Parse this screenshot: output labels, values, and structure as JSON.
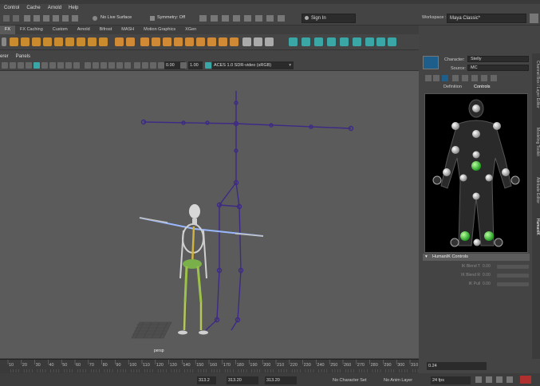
{
  "menu": [
    "Control",
    "Cache",
    "Arnold",
    "Help"
  ],
  "statusline": {
    "live_surface": "No Live Surface",
    "symmetry": "Symmetry: Off",
    "sign_in": "Sign In",
    "workspace_label": "Workspace :",
    "workspace_value": "Maya Classic*"
  },
  "shelf_tabs": [
    "FX",
    "FX Caching",
    "Custom",
    "Arnold",
    "Bifrost",
    "MASH",
    "Motion Graphics",
    "XGen"
  ],
  "panel_menu": [
    "erer",
    "Panels"
  ],
  "viewport_toolbar": {
    "value_a": "0.00",
    "value_b": "1.00",
    "colorspace": "ACES 1.0 SDR-video (sRGB)"
  },
  "viewport": {
    "camera_label": "persp"
  },
  "humanik": {
    "character_label": "Character:",
    "character_value": "Stelly",
    "source_label": "Source:",
    "source_value": "MC",
    "tabs": [
      "Definition",
      "Controls"
    ],
    "controls_header": "HumanIK Controls",
    "controls": [
      {
        "label": "IK Blend T",
        "value": "0.00"
      },
      {
        "label": "IK Blend R",
        "value": "0.00"
      },
      {
        "label": "IK Pull",
        "value": "0.00"
      }
    ]
  },
  "side_tabs": [
    "Channel Box / Layer Editor",
    "Modeling Toolkit",
    "Attribute Editor",
    "HumanIK"
  ],
  "timeline": {
    "ticks": [
      "10",
      "20",
      "30",
      "40",
      "50",
      "60",
      "70",
      "80",
      "90",
      "100",
      "110",
      "120",
      "130",
      "140",
      "150",
      "160",
      "170",
      "180",
      "190",
      "200",
      "210",
      "220",
      "230",
      "240",
      "250",
      "260",
      "270",
      "280",
      "290",
      "300",
      "310"
    ],
    "current_frame": "0.24"
  },
  "range_bar": {
    "start": "313.2",
    "range_start": "313.20",
    "range_end": "313.20",
    "character_set": "No Character Set",
    "anim_layer": "No Anim Layer",
    "fps": "24 fps"
  },
  "colors": {
    "accent_teal": "#3aa6a6",
    "hik_green": "#35c735",
    "skeleton_purple": "#3e2a86"
  }
}
